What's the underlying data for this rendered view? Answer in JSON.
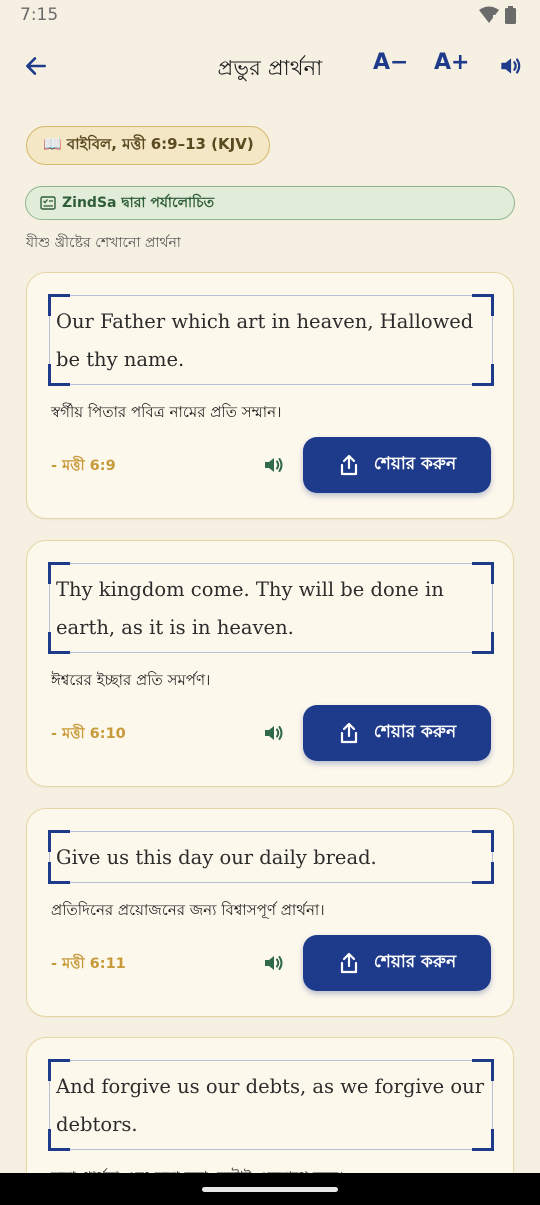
{
  "status_bar": {
    "time": "7:15"
  },
  "header": {
    "title": "প্রভুর প্রার্থনা",
    "font_decrease": "A−",
    "font_increase": "A+"
  },
  "source_badge": "📖 বাইবিল, মত্তী 6:9–13 (KJV)",
  "review_badge": "ZindSa দ্বারা পর্যালোচিত",
  "subtitle": "যীশু খ্রীষ্টের শেখানো প্রার্থনা",
  "verses": [
    {
      "english": "Our Father which art in heaven, Hallowed be thy name.",
      "bengali": "স্বর্গীয় পিতার পবিত্র নামের প্রতি সম্মান।",
      "reference": "- মত্তী 6:9",
      "share_label": "শেয়ার করুন"
    },
    {
      "english": "Thy kingdom come. Thy will be done in earth, as it is in heaven.",
      "bengali": "ঈশ্বরের ইচ্ছার প্রতি সমর্পণ।",
      "reference": "- মত্তী 6:10",
      "share_label": "শেয়ার করুন"
    },
    {
      "english": "Give us this day our daily bread.",
      "bengali": "প্রতিদিনের প্রয়োজনের জন্য বিশ্বাসপূর্ণ প্রার্থনা।",
      "reference": "- মত্তী 6:11",
      "share_label": "শেয়ার করুন"
    },
    {
      "english": "And forgive us our debts, as we forgive our debtors.",
      "bengali": "ক্ষমা প্রার্থনা এবং ক্ষমা করা, দুটোই একসাথে চলে।"
    }
  ],
  "colors": {
    "background": "#f6f0e2",
    "accent": "#1e3a8a",
    "card": "#fdf8ec",
    "reference": "#c79a3a",
    "review_green": "#2f5d3a"
  }
}
